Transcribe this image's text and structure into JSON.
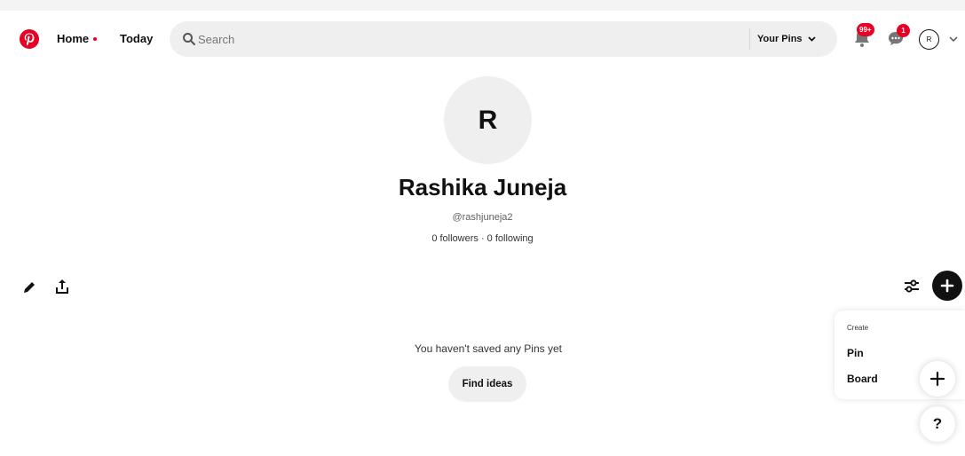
{
  "colors": {
    "brand": "#e60023",
    "surface": "#efefef",
    "text": "#111111"
  },
  "header": {
    "logo_icon": "pinterest-logo-icon",
    "nav": {
      "home": "Home",
      "today": "Today"
    },
    "search": {
      "placeholder": "Search",
      "icon": "search-icon"
    },
    "your_pins_label": "Your Pins",
    "notifications_badge": "99+",
    "messages_badge": "1",
    "account_initial": "R"
  },
  "profile": {
    "initial": "R",
    "name": "Rashika Juneja",
    "handle": "@rashjuneja2",
    "stats": "0 followers · 0 following"
  },
  "toolbar": {
    "edit_icon": "pencil-icon",
    "share_icon": "share-icon",
    "filter_icon": "sliders-icon",
    "add_icon": "plus-icon"
  },
  "main": {
    "empty_message": "You haven't saved any Pins yet",
    "find_ideas_label": "Find ideas"
  },
  "create_menu": {
    "title": "Create",
    "items": [
      "Pin",
      "Board"
    ]
  },
  "fab": {
    "help_label": "?"
  }
}
